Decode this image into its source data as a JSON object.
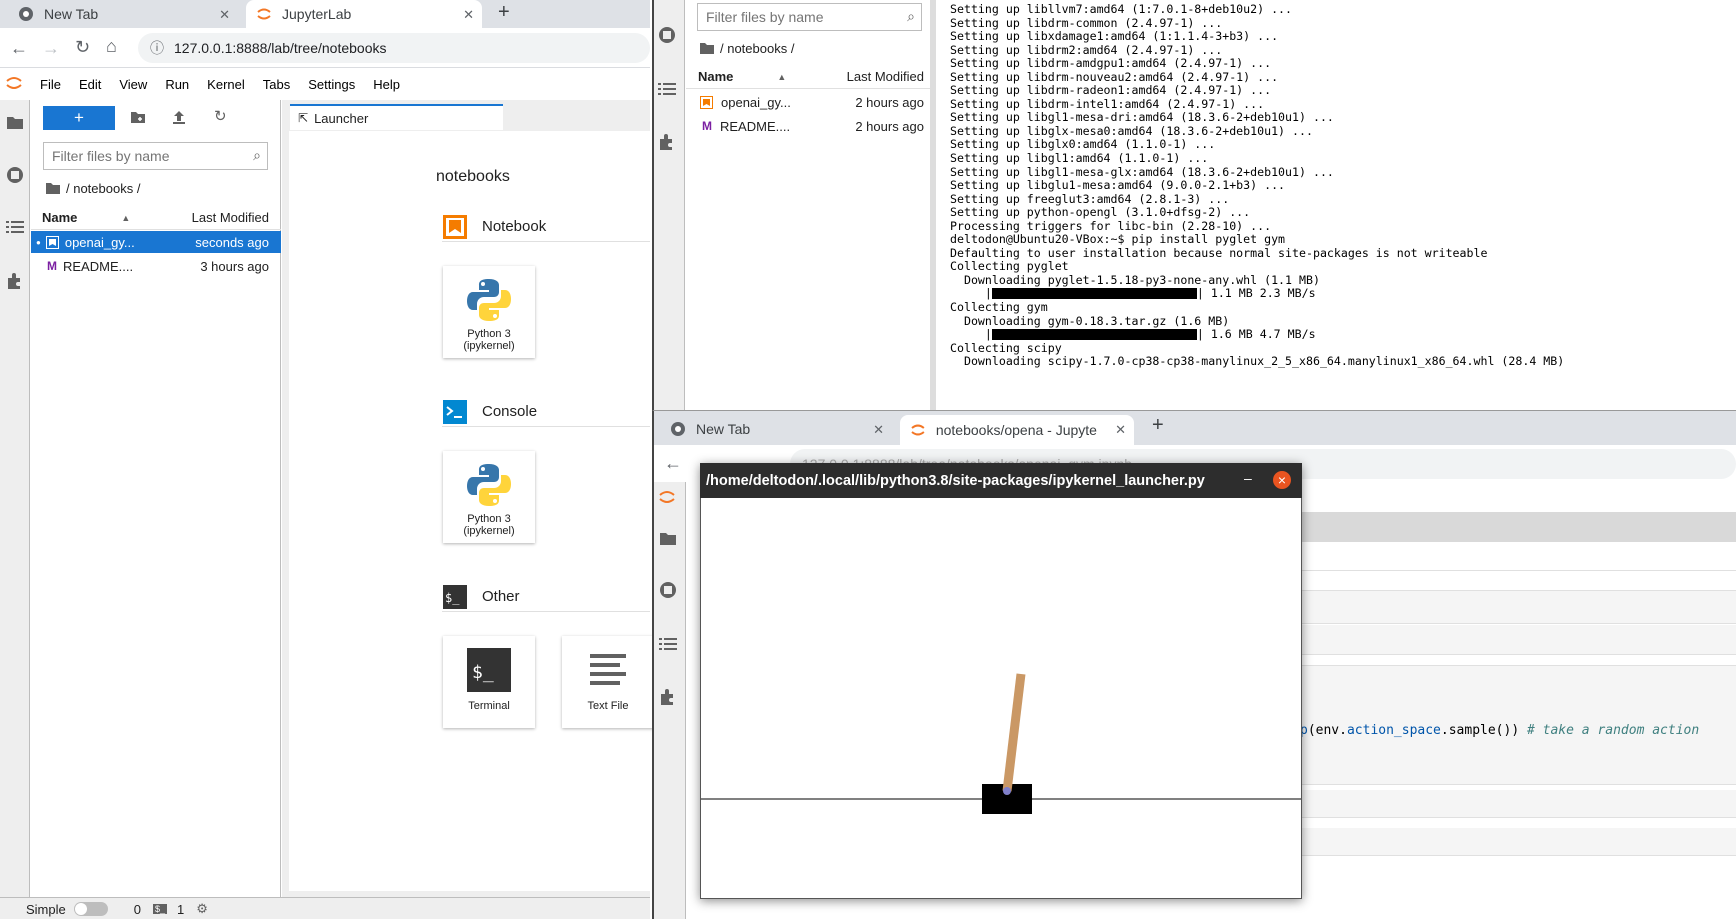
{
  "browser1": {
    "tabs": [
      {
        "label": "New Tab",
        "icon": "chrome-icon"
      },
      {
        "label": "JupyterLab",
        "icon": "jupyter-icon"
      }
    ],
    "url": "127.0.0.1:8888/lab/tree/notebooks"
  },
  "jupyter": {
    "menu": [
      "File",
      "Edit",
      "View",
      "Run",
      "Kernel",
      "Tabs",
      "Settings",
      "Help"
    ],
    "new_button": "+",
    "filter_placeholder": "Filter files by name",
    "breadcrumb": "/ notebooks /",
    "columns": {
      "name": "Name",
      "modified": "Last Modified"
    },
    "files": [
      {
        "name": "openai_gy...",
        "modified": "seconds ago",
        "icon": "notebook-icon",
        "selected": true
      },
      {
        "name": "README....",
        "modified": "3 hours ago",
        "icon": "markdown-icon",
        "selected": false
      }
    ],
    "launcher_tab": "Launcher",
    "launcher_path": "notebooks",
    "sections": [
      {
        "title": "Notebook",
        "cards": [
          {
            "label1": "Python 3",
            "label2": "(ipykernel)"
          }
        ]
      },
      {
        "title": "Console",
        "cards": [
          {
            "label1": "Python 3",
            "label2": "(ipykernel)"
          }
        ]
      },
      {
        "title": "Other",
        "cards": [
          {
            "label1": "Terminal",
            "label2": ""
          },
          {
            "label1": "Text File",
            "label2": ""
          }
        ]
      }
    ],
    "status": {
      "mode": "Simple",
      "count1": "0",
      "count2": "1"
    }
  },
  "panel2": {
    "filter_placeholder": "Filter files by name",
    "breadcrumb": "/ notebooks /",
    "columns": {
      "name": "Name",
      "modified": "Last Modified"
    },
    "files": [
      {
        "name": "openai_gy...",
        "modified": "2 hours ago"
      },
      {
        "name": "README....",
        "modified": "2 hours ago"
      }
    ]
  },
  "terminal": {
    "lines": [
      "Setting up libllvm7:amd64 (1:7.0.1-8+deb10u2) ...",
      "Setting up libdrm-common (2.4.97-1) ...",
      "Setting up libxdamage1:amd64 (1:1.1.4-3+b3) ...",
      "Setting up libdrm2:amd64 (2.4.97-1) ...",
      "Setting up libdrm-amdgpu1:amd64 (2.4.97-1) ...",
      "Setting up libdrm-nouveau2:amd64 (2.4.97-1) ...",
      "Setting up libdrm-radeon1:amd64 (2.4.97-1) ...",
      "Setting up libdrm-intel1:amd64 (2.4.97-1) ...",
      "Setting up libgl1-mesa-dri:amd64 (18.3.6-2+deb10u1) ...",
      "Setting up libglx-mesa0:amd64 (18.3.6-2+deb10u1) ...",
      "Setting up libglx0:amd64 (1.1.0-1) ...",
      "Setting up libgl1:amd64 (1.1.0-1) ...",
      "Setting up libgl1-mesa-glx:amd64 (18.3.6-2+deb10u1) ...",
      "Setting up libglu1-mesa:amd64 (9.0.0-2.1+b3) ...",
      "Setting up freeglut3:amd64 (2.8.1-3) ...",
      "Setting up python-opengl (3.1.0+dfsg-2) ...",
      "Processing triggers for libc-bin (2.28-10) ...",
      "deltodon@Ubuntu20-VBox:~$ pip install pyglet gym",
      "Defaulting to user installation because normal site-packages is not writeable",
      "Collecting pyglet",
      "  Downloading pyglet-1.5.18-py3-none-any.whl (1.1 MB)"
    ],
    "progress1": "1.1 MB 2.3 MB/s",
    "lines2": [
      "Collecting gym",
      "  Downloading gym-0.18.3.tar.gz (1.6 MB)"
    ],
    "progress2": "1.6 MB 4.7 MB/s",
    "lines3": [
      "Collecting scipy",
      "  Downloading scipy-1.7.0-cp38-cp38-manylinux_2_5_x86_64.manylinux1_x86_64.whl (28.4 MB)"
    ]
  },
  "browser2": {
    "tabs": [
      {
        "label": "New Tab"
      },
      {
        "label": "notebooks/opena - Jupyte"
      }
    ],
    "url": "127.0.0.1:8888/lab/tree/notebooks/openai_gym.ipynb"
  },
  "code_fragment": {
    "prefix": "p",
    "text": "(env.",
    "attr": "action_space",
    "call": ".sample())",
    "comment": "# take a random action"
  },
  "gym_window": {
    "title": "/home/deltodon/.local/lib/python3.8/site-packages/ipykernel_launcher.py",
    "minimize": "–",
    "close": "×"
  },
  "colors": {
    "accent": "#1976d2",
    "orange": "#f57c00",
    "close_red": "#e95420",
    "pole": "#ca9865",
    "cart": "#000000"
  }
}
